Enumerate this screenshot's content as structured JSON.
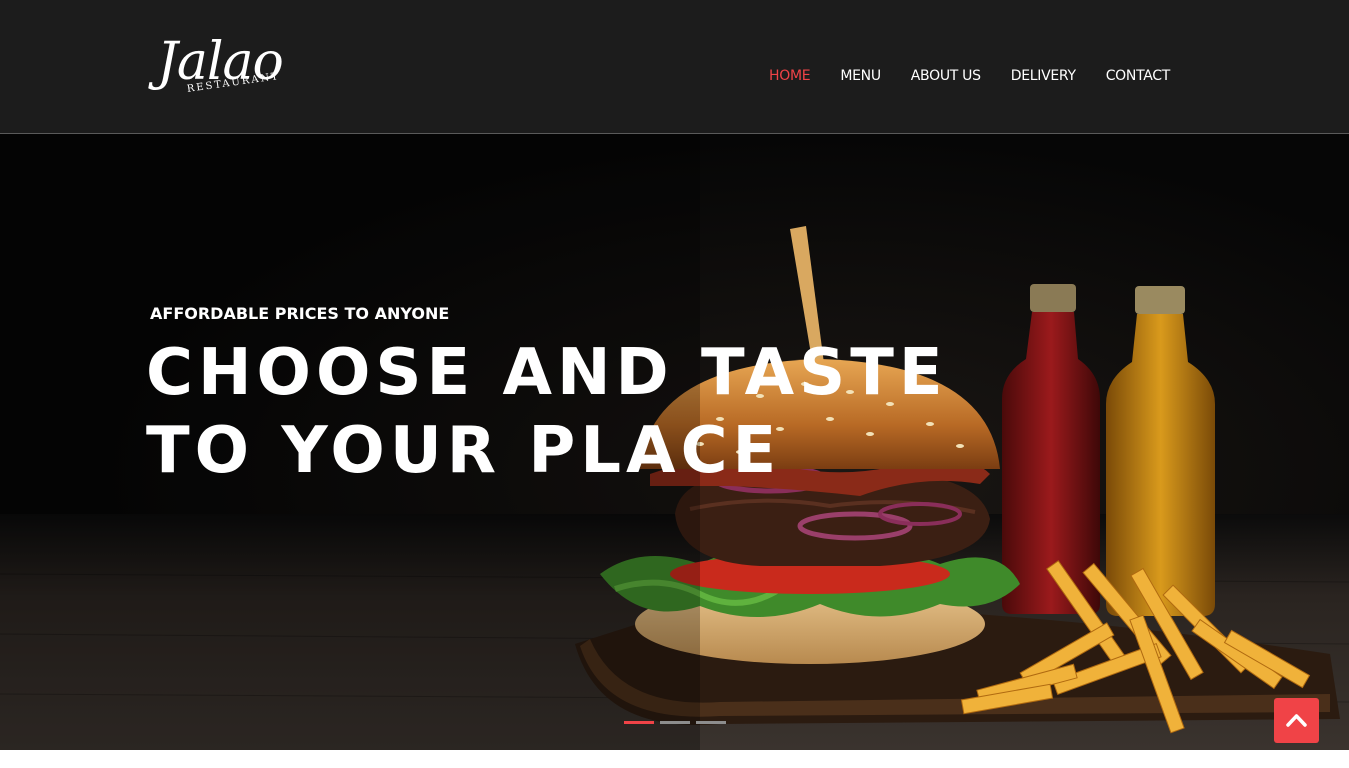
{
  "brand": {
    "logo_script": "Jalao",
    "logo_sub": "RESTAURANT"
  },
  "nav": {
    "items": [
      {
        "label": "HOME",
        "active": true
      },
      {
        "label": "MENU",
        "active": false
      },
      {
        "label": "ABOUT US",
        "active": false
      },
      {
        "label": "DELIVERY",
        "active": false
      },
      {
        "label": "CONTACT",
        "active": false
      }
    ]
  },
  "hero": {
    "kicker": "AFFORDABLE PRICES TO ANYONE",
    "title_line1": "CHOOSE AND TASTE",
    "title_line2": "TO YOUR PLACE",
    "slides_total": 3,
    "slide_active": 1
  },
  "icons": {
    "back_to_top": "chevron-up-icon"
  },
  "colors": {
    "accent": "#f04347",
    "header_bg": "#1c1c1c",
    "nav_text": "#ffffff"
  }
}
